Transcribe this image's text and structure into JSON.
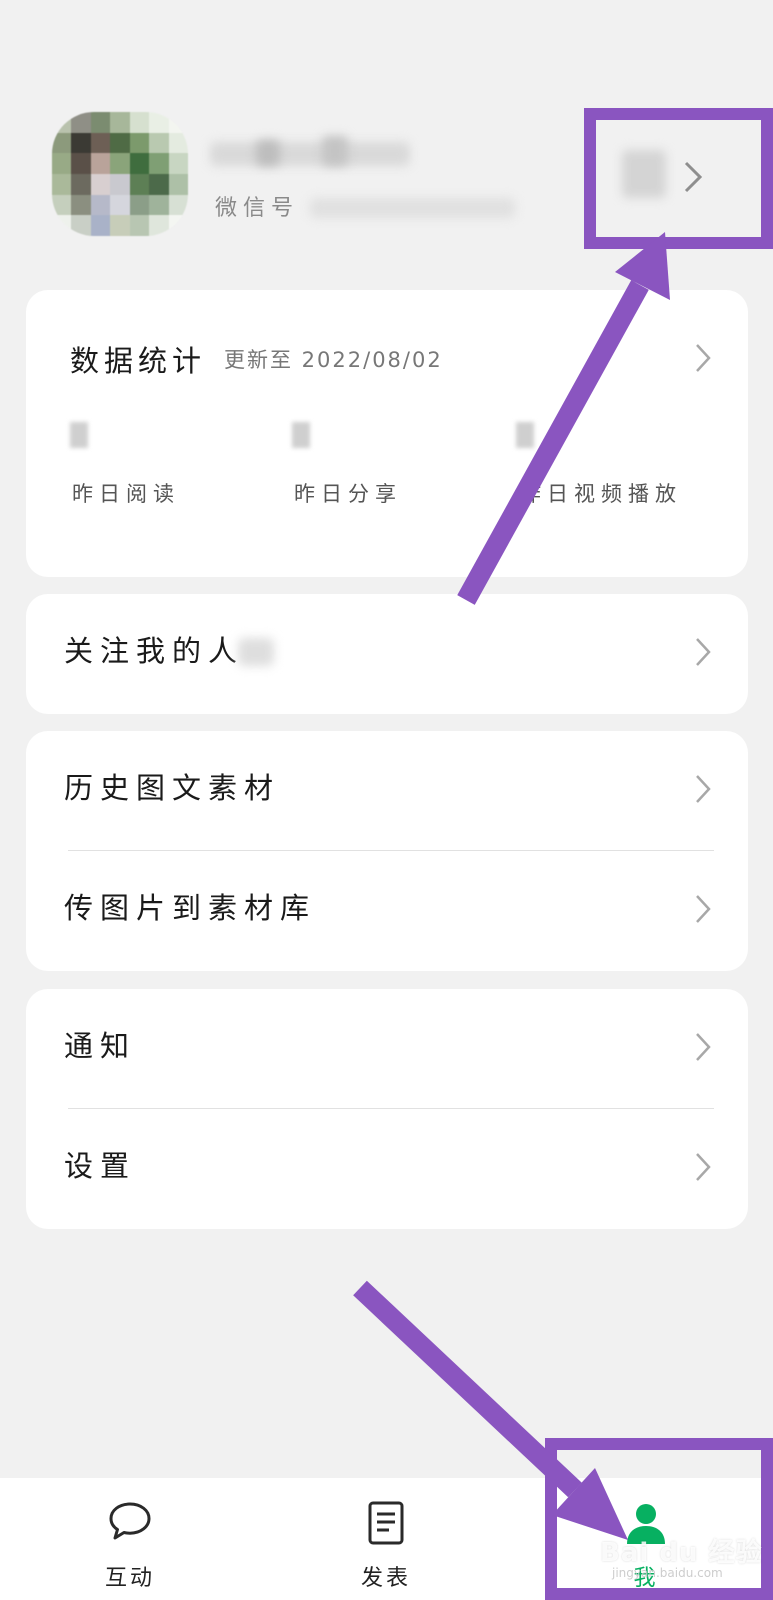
{
  "profile": {
    "wechat_id_label": "微信号"
  },
  "stats": {
    "title": "数据统计",
    "updated": "更新至 2022/08/02",
    "items": [
      {
        "label": "昨日阅读"
      },
      {
        "label": "昨日分享"
      },
      {
        "label": "昨日视频播放"
      }
    ]
  },
  "menu": {
    "followers": "关注我的人",
    "history": "历史图文素材",
    "upload": "传图片到素材库",
    "notify": "通知",
    "settings": "设置"
  },
  "tabbar": {
    "tabs": [
      {
        "label": "互动",
        "icon": "chat-bubble-icon"
      },
      {
        "label": "发表",
        "icon": "document-icon"
      },
      {
        "label": "我",
        "icon": "person-icon"
      }
    ],
    "active": "我"
  },
  "watermark": {
    "text": "Bai du 经验",
    "sub": "jingyan.baidu.com"
  },
  "colors": {
    "background": "#f1f1f1",
    "card": "#ffffff",
    "accent_green": "#07b061",
    "annotation_purple": "#8a55c0"
  }
}
